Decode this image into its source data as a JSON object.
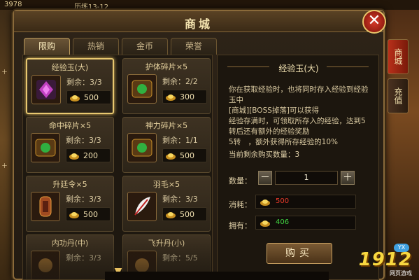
{
  "topbar": {
    "level": "3978",
    "title": "历练13-12"
  },
  "window": {
    "title": "商城",
    "close": "✕"
  },
  "tabs": [
    {
      "label": "限购",
      "active": true
    },
    {
      "label": "热销",
      "active": false
    },
    {
      "label": "金币",
      "active": false
    },
    {
      "label": "荣誉",
      "active": false
    }
  ],
  "items": [
    {
      "name": "经验玉(大)",
      "stock": "剩余：3/3",
      "price": "500",
      "icon": "jade-icon"
    },
    {
      "name": "护体碎片×5",
      "stock": "剩余：2/2",
      "price": "300",
      "icon": "shard-icon"
    },
    {
      "name": "命中碎片×5",
      "stock": "剩余：3/3",
      "price": "200",
      "icon": "shard-icon"
    },
    {
      "name": "神力碎片×5",
      "stock": "剩余：1/1",
      "price": "500",
      "icon": "shard-icon"
    },
    {
      "name": "升廷令×5",
      "stock": "剩余：3/3",
      "price": "500",
      "icon": "token-icon"
    },
    {
      "name": "羽毛×5",
      "stock": "剩余：3/3",
      "price": "500",
      "icon": "feather-icon"
    },
    {
      "name": "内功丹(中)",
      "stock": "剩余：3/3",
      "price": "",
      "icon": "pill-icon"
    },
    {
      "name": "飞升丹(小)",
      "stock": "剩余：5/5",
      "price": "",
      "icon": "pill-icon"
    }
  ],
  "detail": {
    "title": "经验玉(大)",
    "desc": [
      "你在获取经验时，也将同时存入经验到经验玉中",
      "[商城][BOSS掉落]可以获得",
      "经验存满时，可领取所存入的经验，达到5转后还有额外的经验奖励",
      "5转　，额外获得所存经验的10%"
    ],
    "remain": "当前剩余购买数量：3",
    "qty_label": "数量：",
    "qty_value": "1",
    "minus": "－",
    "plus": "＋",
    "cost_label": "消耗：",
    "cost_value": "500",
    "own_label": "拥有：",
    "own_value": "406",
    "buy": "购买"
  },
  "side": {
    "shop": "商城",
    "charge": "充值"
  },
  "logo": {
    "text": "1912",
    "sub": "网页游戏",
    "badge": "YX"
  },
  "colors": {
    "gold": "#e8c060",
    "cost": "#e83a2a",
    "own": "#40d040",
    "accent": "#b8301a"
  }
}
